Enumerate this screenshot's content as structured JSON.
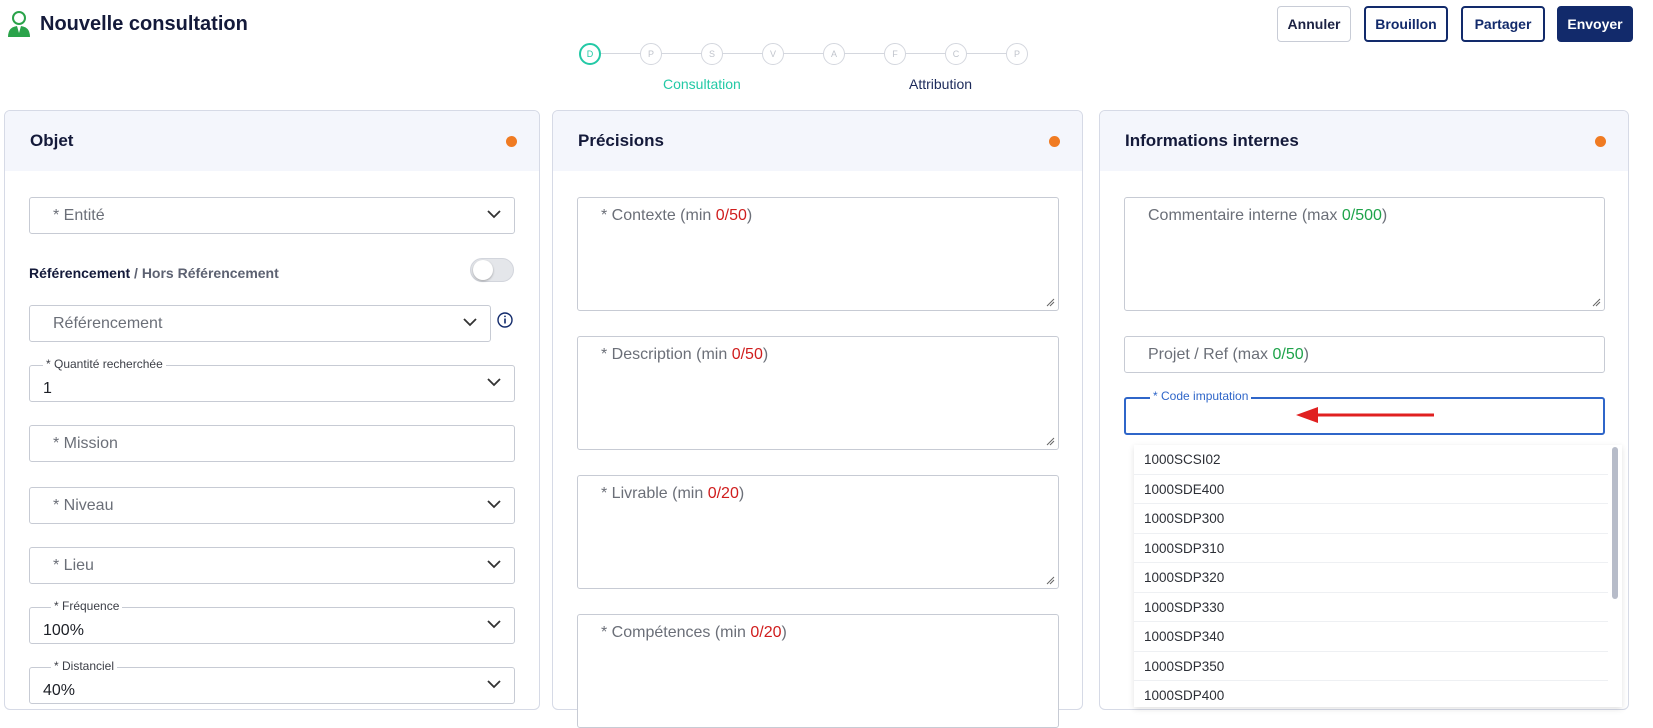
{
  "header": {
    "title": "Nouvelle consultation",
    "buttons": {
      "cancel": "Annuler",
      "draft": "Brouillon",
      "share": "Partager",
      "send": "Envoyer"
    }
  },
  "stepper": {
    "steps": [
      "D",
      "P",
      "S",
      "V",
      "A",
      "F",
      "C",
      "P"
    ],
    "active_index": 0,
    "labels": {
      "consultation": "Consultation",
      "attribution": "Attribution"
    }
  },
  "colors": {
    "primary": "#122a6b",
    "accent": "#23c9a6",
    "status_dot": "#f07b22",
    "error_count": "#d01d1d",
    "ok_count": "#1ea34a",
    "arrow": "#e02020"
  },
  "panel_objet": {
    "title": "Objet",
    "entite": "* Entité",
    "ref_label_a": "Référencement",
    "ref_label_b": " / Hors Référencement",
    "referencement": "Référencement",
    "quantite_label": "* Quantité recherchée",
    "quantite_value": "1",
    "mission": "* Mission",
    "niveau": "* Niveau",
    "lieu": "* Lieu",
    "frequence_label": "* Fréquence",
    "frequence_value": "100%",
    "distanciel_label": "* Distanciel",
    "distanciel_value": "40%"
  },
  "panel_precisions": {
    "title": "Précisions",
    "contexte": {
      "label": "* Contexte (min ",
      "count": "0/50",
      "end": ")"
    },
    "description": {
      "label": "* Description (min ",
      "count": "0/50",
      "end": ")"
    },
    "livrable": {
      "label": "* Livrable (min ",
      "count": "0/20",
      "end": ")"
    },
    "competences": {
      "label": "* Compétences (min ",
      "count": "0/20",
      "end": ")"
    }
  },
  "panel_infos": {
    "title": "Informations internes",
    "commentaire": {
      "label": "Commentaire interne (max ",
      "count": "0/500",
      "end": ")"
    },
    "projet": {
      "label": "Projet / Ref (max ",
      "count": "0/50",
      "end": ")"
    },
    "code_imputation_label": "* Code imputation",
    "options": [
      "1000SCSI02",
      "1000SDE400",
      "1000SDP300",
      "1000SDP310",
      "1000SDP320",
      "1000SDP330",
      "1000SDP340",
      "1000SDP350",
      "1000SDP400"
    ]
  }
}
